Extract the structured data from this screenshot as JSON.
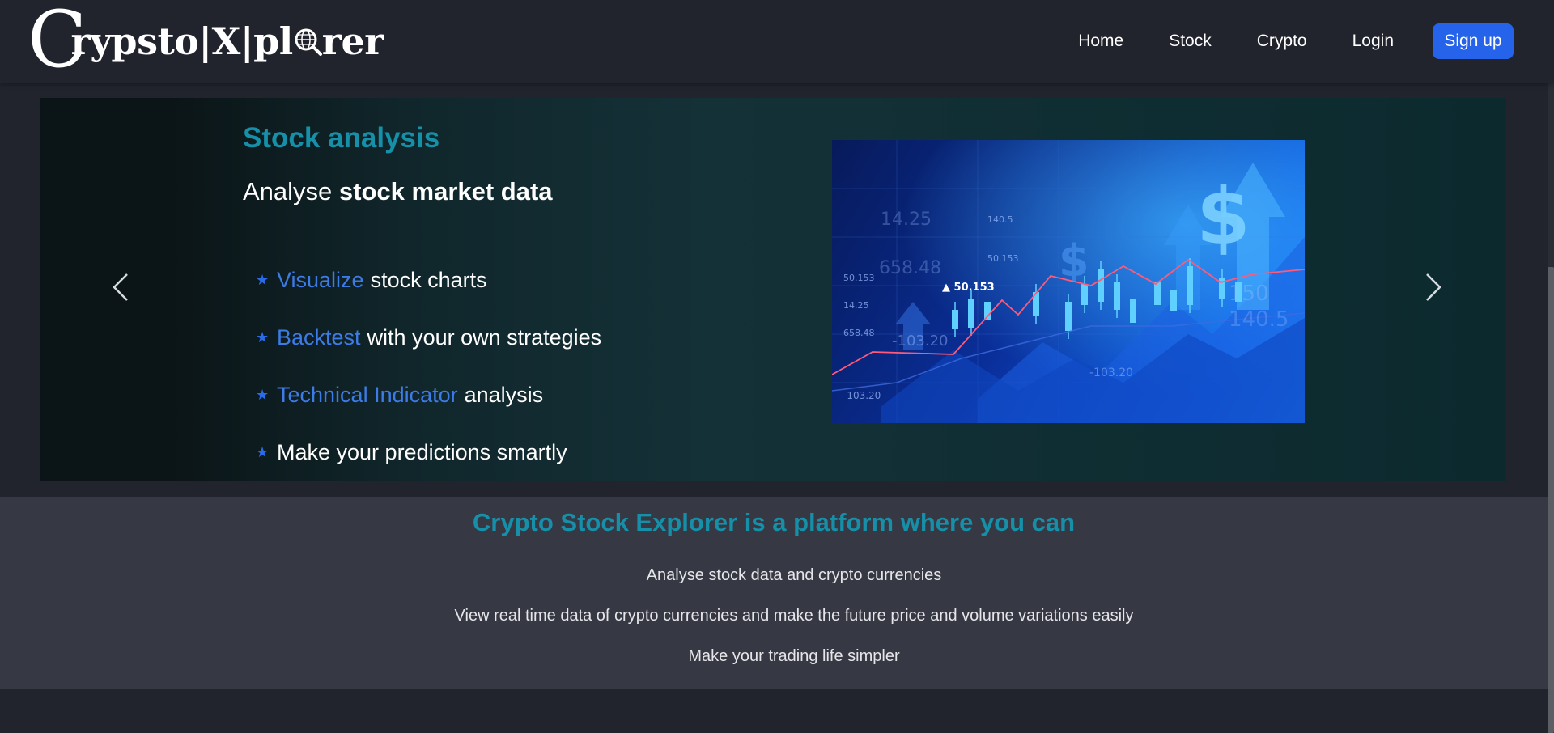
{
  "nav": {
    "brand": "Crypsto|X|plorer",
    "links": [
      "Home",
      "Stock",
      "Crypto",
      "Login"
    ],
    "signup_label": "Sign up",
    "accent": "#2563eb"
  },
  "hero": {
    "title": "Stock analysis",
    "subtitle_plain": "Analyse",
    "subtitle_bold": "stock market data",
    "features": [
      {
        "highlight": "Visualize",
        "rest": "stock charts"
      },
      {
        "highlight": "Backtest",
        "rest": "with your own strategies"
      },
      {
        "highlight": "Technical Indicator",
        "rest": "analysis"
      },
      {
        "highlight": "",
        "rest": "Make your predictions smartly"
      }
    ],
    "image_labels": [
      "14.25",
      "140.5",
      "50.153",
      "658.48",
      "50.153",
      "14.25",
      "658.48",
      "-103.20",
      "-103.20",
      "-103.20",
      "150",
      "140.5"
    ],
    "title_color": "#168fa8",
    "highlight_color": "#3d7be6"
  },
  "info": {
    "title": "Crypto Stock Explorer is a platform where you can",
    "lines": [
      "Analyse stock data and crypto currencies",
      "View real time data of crypto currencies and make the future price and volume variations easily",
      "Make your trading life simpler"
    ]
  }
}
